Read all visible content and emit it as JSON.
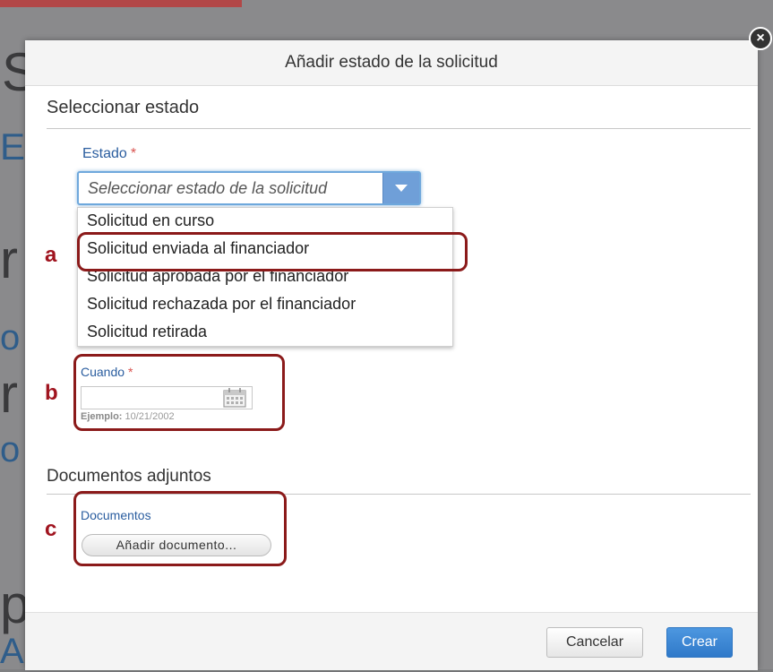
{
  "modal": {
    "title": "Añadir estado de la solicitud",
    "close_glyph": "×"
  },
  "section_status": {
    "title": "Seleccionar estado",
    "estado_label": "Estado",
    "required_mark": "*",
    "select_placeholder": "Seleccionar estado de la solicitud",
    "options": [
      "Solicitud en curso",
      "Solicitud enviada al financiador",
      "Solicitud aprobada por el financiador",
      "Solicitud rechazada por el financiador",
      "Solicitud retirada"
    ],
    "cuando_label": "Cuando",
    "date_value": "",
    "hint_label": "Ejemplo:",
    "hint_value": "10/21/2002"
  },
  "section_docs": {
    "title": "Documentos adjuntos",
    "documents_label": "Documentos",
    "add_button": "Añadir documento..."
  },
  "callouts": {
    "a": "a",
    "b": "b",
    "c": "c",
    "color": "#8b1a1a"
  },
  "footer": {
    "cancel": "Cancelar",
    "create": "Crear"
  },
  "colors": {
    "accent": "#2f79c9",
    "label": "#2a5d9f",
    "required": "#d9534f"
  },
  "icons": {
    "close": "close-icon",
    "dropdown": "chevron-down-icon",
    "calendar": "calendar-icon"
  }
}
